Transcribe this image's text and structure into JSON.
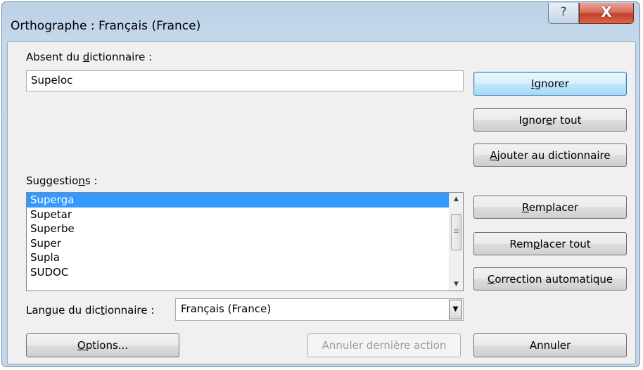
{
  "window": {
    "title": "Orthographe : Français (France)",
    "help_glyph": "?",
    "close_glyph": "X"
  },
  "not_in_dictionary": {
    "label_prefix": "Absent du ",
    "label_underlined": "d",
    "label_suffix": "ictionnaire :",
    "value": "Supeloc"
  },
  "suggestions": {
    "label_prefix": "Suggestio",
    "label_underlined": "n",
    "label_suffix": "s :",
    "items": [
      "Superga",
      "Supetar",
      "Superbe",
      "Super",
      "Supla",
      "SUDOC"
    ],
    "selected_index": 0
  },
  "language": {
    "label_prefix": "Langue du dic",
    "label_underlined": "t",
    "label_suffix": "ionnaire :",
    "value": "Français (France)"
  },
  "buttons": {
    "ignore": {
      "underlined": "I",
      "rest": "gnorer"
    },
    "ignore_all": {
      "before": "Ignor",
      "underlined": "e",
      "after": "r tout"
    },
    "add_dictionary": {
      "underlined": "A",
      "rest": "jouter au dictionnaire"
    },
    "replace": {
      "underlined": "R",
      "rest": "emplacer"
    },
    "replace_all": {
      "before": "Rem",
      "underlined": "p",
      "after": "lacer tout"
    },
    "autocorrect": {
      "underlined": "C",
      "rest": "orrection automatique"
    },
    "options": {
      "underlined": "O",
      "rest": "ptions..."
    },
    "undo_last": "Annuler dernière action",
    "cancel": "Annuler"
  },
  "colors": {
    "selection": "#3399ff",
    "close_button": "#c2402a",
    "window_frame": "#c3d5e8"
  },
  "icons": {
    "help": "question-mark-icon",
    "close": "close-x-icon",
    "scroll_up": "triangle-up-icon",
    "scroll_down": "triangle-down-icon",
    "dropdown": "triangle-down-icon"
  }
}
